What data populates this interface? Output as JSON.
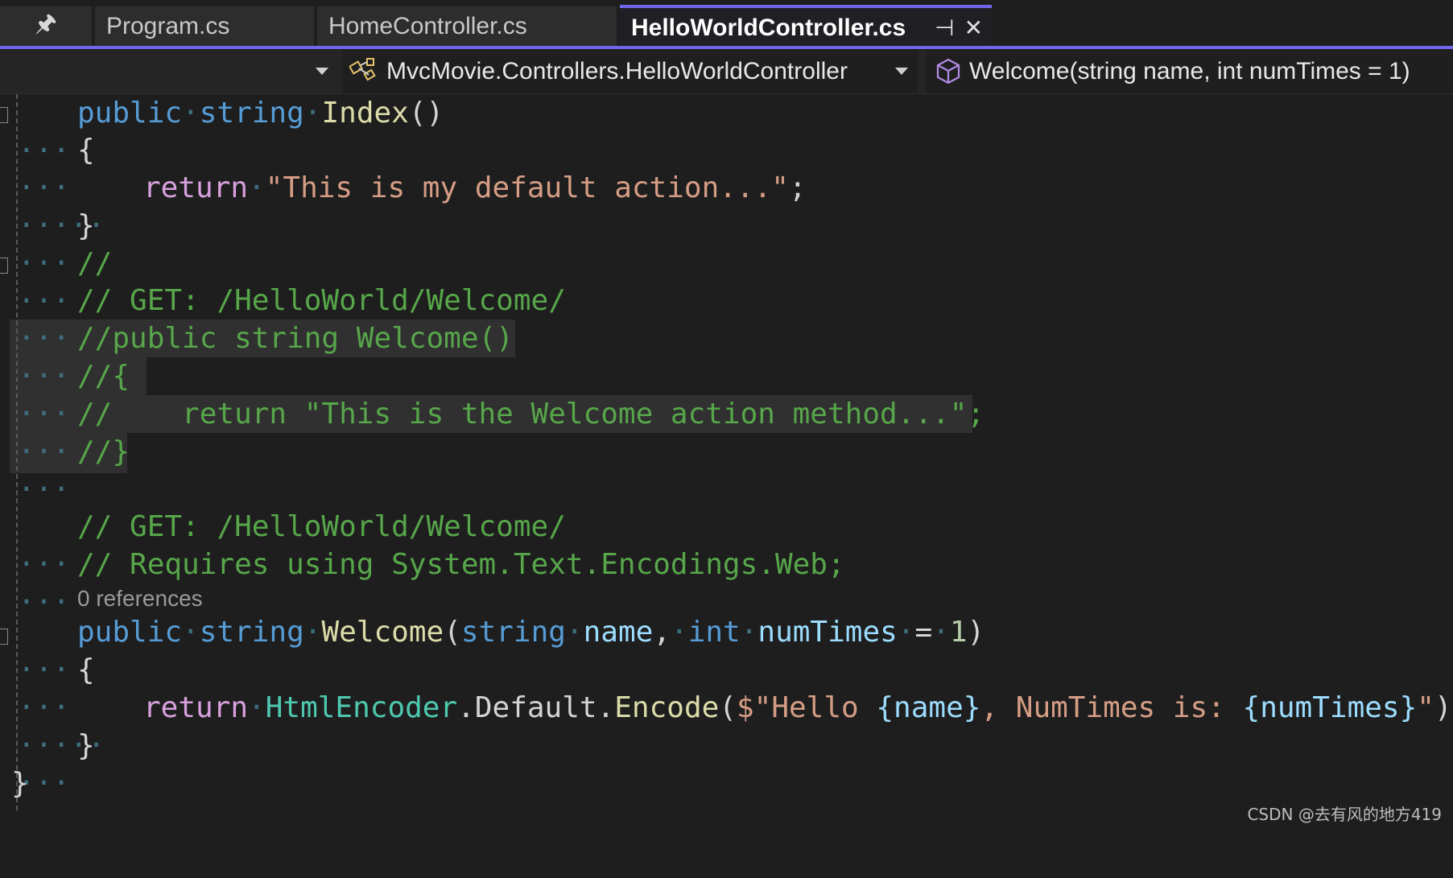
{
  "tabs": {
    "pin_glyph": "🖈",
    "items": [
      {
        "label": "Program.cs"
      },
      {
        "label": "HomeController.cs"
      },
      {
        "label": "HelloWorldController.cs",
        "active": true
      }
    ],
    "pin_button": "⊣",
    "close_button": "✕"
  },
  "navbar": {
    "class_dropdown": "MvcMovie.Controllers.HelloWorldController",
    "member_dropdown": "Welcome(string name, int numTimes = 1)"
  },
  "code": {
    "line1": {
      "kw1": "public",
      "kw2": "string",
      "meth": "Index",
      "rest": "()"
    },
    "line2": "{",
    "line3": {
      "ctl": "return",
      "str": "\"This is my default action...\"",
      "end": ";"
    },
    "line4": "}",
    "line5": "//",
    "line6": "// GET: /HelloWorld/Welcome/",
    "line7": "//public string Welcome()",
    "line8": "//{",
    "line9": "//    return \"This is the Welcome action method...\";",
    "line10": "//}",
    "line11": "// GET: /HelloWorld/Welcome/",
    "line12": "// Requires using System.Text.Encodings.Web;",
    "references": "0 references",
    "line13": {
      "kw1": "public",
      "kw2": "string",
      "meth": "Welcome",
      "open": "(",
      "kw3": "string",
      "p1": "name",
      "comma": ",",
      "kw4": "int",
      "p2": "numTimes",
      "eq": "=",
      "num": "1",
      "close": ")"
    },
    "line14": "{",
    "line15": {
      "ctl": "return",
      "typ": "HtmlEncoder",
      "dot1": ".",
      "prop": "Default",
      "dot2": ".",
      "meth": "Encode",
      "open": "(",
      "s1": "$\"Hello ",
      "i1": "{name}",
      "s2": ", NumTimes is: ",
      "i2": "{numTimes}",
      "s3": "\"",
      "close": ");"
    },
    "line16": "}",
    "line17": "}"
  },
  "watermark": "CSDN @去有风的地方419"
}
